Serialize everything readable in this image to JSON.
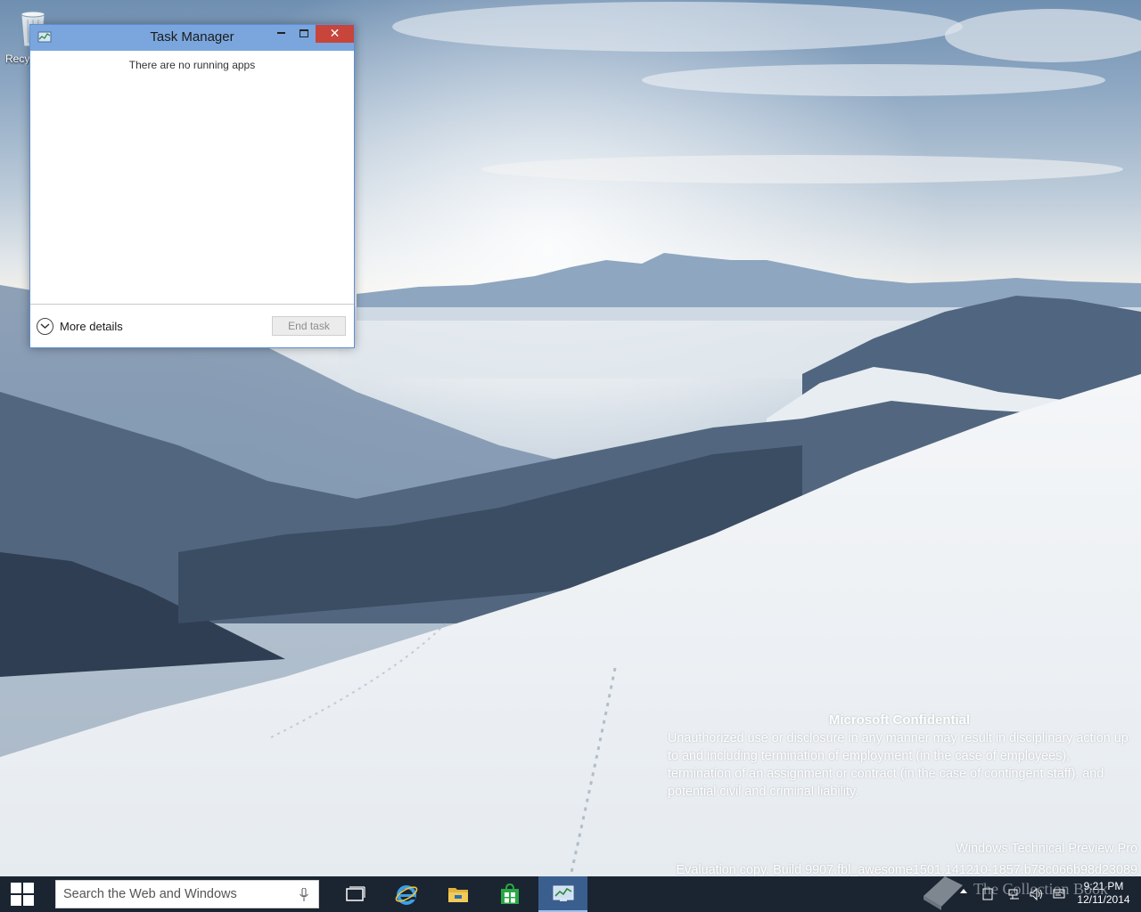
{
  "desktop": {
    "icons": [
      {
        "label": "Recycle Bin",
        "icon": "recycle-bin-icon"
      }
    ]
  },
  "task_manager": {
    "title": "Task Manager",
    "close_glyph": "✕",
    "empty_message": "There are no running apps",
    "more_details_label": "More details",
    "end_task_label": "End task",
    "end_task_enabled": false
  },
  "watermark": {
    "title": "Microsoft Confidential",
    "body": "Unauthorized use or disclosure in any manner may result in disciplinary action up to and including termination of employment (in the case of employees), termination of an assignment or contract (in the case of contingent staff), and potential civil and criminal liability.",
    "edition": "Windows Technical Preview Pro",
    "build": "Evaluation copy. Build 9907.fbl_awesome1501.141210-1857.b78c066b98d23089"
  },
  "taskbar": {
    "search_placeholder": "Search the Web and Windows",
    "pinned_apps": [
      {
        "name": "task-view",
        "icon": "task-view-icon"
      },
      {
        "name": "internet-explorer",
        "icon": "internet-explorer-icon"
      },
      {
        "name": "file-explorer",
        "icon": "folder-icon"
      },
      {
        "name": "store",
        "icon": "store-icon"
      },
      {
        "name": "task-manager",
        "icon": "task-manager-icon",
        "active": true
      }
    ],
    "clock": {
      "time": "9:21 PM",
      "date": "12/11/2014"
    }
  },
  "overlay_watermark": "The Collection Book",
  "colors": {
    "taskbar": "#1b2431",
    "title_bar": "#7aa6dd",
    "close_button": "#c7453a",
    "active_app": "#3a5e8e"
  }
}
